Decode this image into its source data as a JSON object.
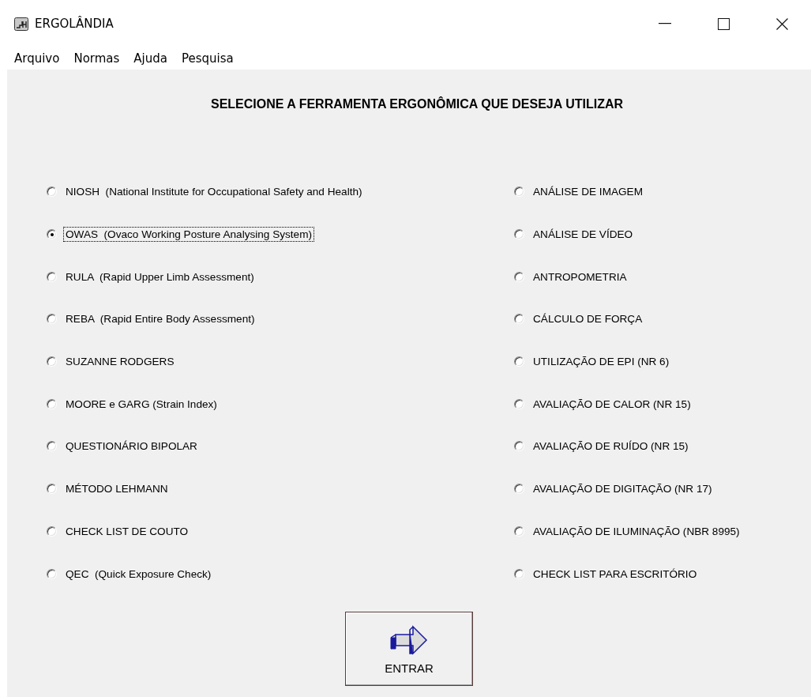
{
  "window": {
    "title": "ERGOLÂNDIA"
  },
  "menu": [
    "Arquivo",
    "Normas",
    "Ajuda",
    "Pesquisa"
  ],
  "heading": "SELECIONE A FERRAMENTA ERGONÔMICA QUE DESEJA UTILIZAR",
  "left_options": [
    {
      "label": "NIOSH  (National Institute for Occupational Safety and Health)",
      "selected": false,
      "focused": false
    },
    {
      "label": "OWAS  (Ovaco Working Posture Analysing System)",
      "selected": true,
      "focused": true
    },
    {
      "label": "RULA  (Rapid Upper Limb Assessment)",
      "selected": false,
      "focused": false
    },
    {
      "label": "REBA  (Rapid Entire Body Assessment)",
      "selected": false,
      "focused": false
    },
    {
      "label": "SUZANNE RODGERS",
      "selected": false,
      "focused": false
    },
    {
      "label": "MOORE e GARG (Strain Index)",
      "selected": false,
      "focused": false
    },
    {
      "label": "QUESTIONÁRIO BIPOLAR",
      "selected": false,
      "focused": false
    },
    {
      "label": "MÉTODO LEHMANN",
      "selected": false,
      "focused": false
    },
    {
      "label": "CHECK LIST DE COUTO",
      "selected": false,
      "focused": false
    },
    {
      "label": "QEC  (Quick Exposure Check)",
      "selected": false,
      "focused": false
    }
  ],
  "right_options": [
    {
      "label": "ANÁLISE DE IMAGEM",
      "selected": false,
      "focused": false
    },
    {
      "label": "ANÁLISE DE VÍDEO",
      "selected": false,
      "focused": false
    },
    {
      "label": "ANTROPOMETRIA",
      "selected": false,
      "focused": false
    },
    {
      "label": "CÁLCULO DE FORÇA",
      "selected": false,
      "focused": false
    },
    {
      "label": "UTILIZAÇÃO DE EPI (NR 6)",
      "selected": false,
      "focused": false
    },
    {
      "label": "AVALIAÇÃO DE CALOR (NR 15)",
      "selected": false,
      "focused": false
    },
    {
      "label": "AVALIAÇÃO DE RUÍDO (NR 15)",
      "selected": false,
      "focused": false
    },
    {
      "label": "AVALIAÇÃO DE DIGITAÇÃO (NR 17)",
      "selected": false,
      "focused": false
    },
    {
      "label": "AVALIAÇÃO DE ILUMINAÇÃO (NBR 8995)",
      "selected": false,
      "focused": false
    },
    {
      "label": "CHECK LIST PARA ESCRITÓRIO",
      "selected": false,
      "focused": false
    }
  ],
  "enter_button": {
    "label": "ENTRAR"
  }
}
